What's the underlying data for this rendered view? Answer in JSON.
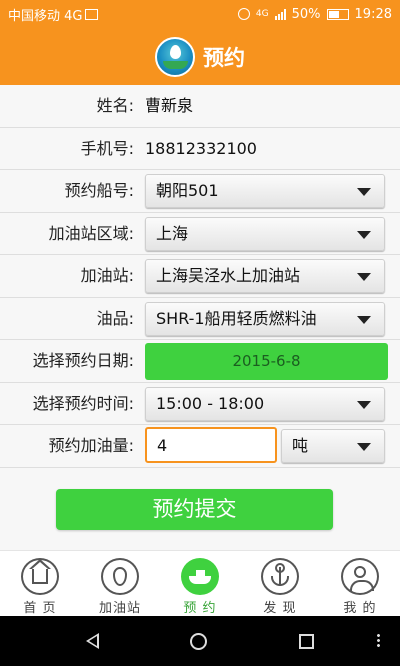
{
  "status_bar": {
    "carrier": "中国移动 4G",
    "network": "4G",
    "battery": "50%",
    "time": "19:28"
  },
  "header": {
    "title": "预约"
  },
  "form": {
    "name_label": "姓名:",
    "name_value": "曹新泉",
    "phone_label": "手机号:",
    "phone_value": "18812332100",
    "ship_label": "预约船号:",
    "ship_value": "朝阳501",
    "region_label": "加油站区域:",
    "region_value": "上海",
    "station_label": "加油站:",
    "station_value": "上海吴泾水上加油站",
    "oil_label": "油品:",
    "oil_value": "SHR-1船用轻质燃料油",
    "date_label": "选择预约日期:",
    "date_value": "2015-6-8",
    "time_label": "选择预约时间:",
    "time_value": "15:00 - 18:00",
    "amount_label": "预约加油量:",
    "amount_value": "4",
    "unit_value": "吨"
  },
  "submit_label": "预约提交",
  "tabs": [
    {
      "label": "首 页",
      "icon": "home-icon",
      "active": false
    },
    {
      "label": "加油站",
      "icon": "fuel-drop-icon",
      "active": false
    },
    {
      "label": "预 约",
      "icon": "ship-icon",
      "active": true
    },
    {
      "label": "发 现",
      "icon": "anchor-icon",
      "active": false
    },
    {
      "label": "我 的",
      "icon": "person-icon",
      "active": false
    }
  ],
  "colors": {
    "header": "#f7931e",
    "accent_green": "#3fd13f",
    "active_tab_text": "#3aa53a"
  }
}
